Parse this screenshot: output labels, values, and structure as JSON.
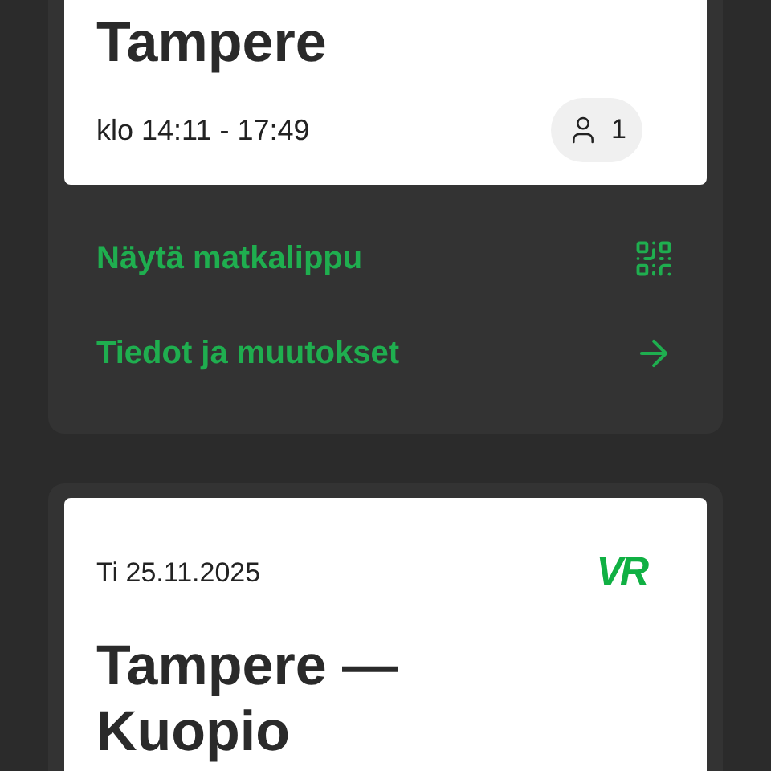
{
  "trips": [
    {
      "title": "Tampere",
      "time": "klo 14:11 - 17:49",
      "passengers": "1",
      "actions": [
        {
          "label": "Näytä matkalippu",
          "kind": "ticket"
        },
        {
          "label": "Tiedot ja muutokset",
          "kind": "details"
        }
      ]
    },
    {
      "date": "Ti 25.11.2025",
      "logo": "VR",
      "title": "Tampere — Kuopio"
    }
  ]
}
